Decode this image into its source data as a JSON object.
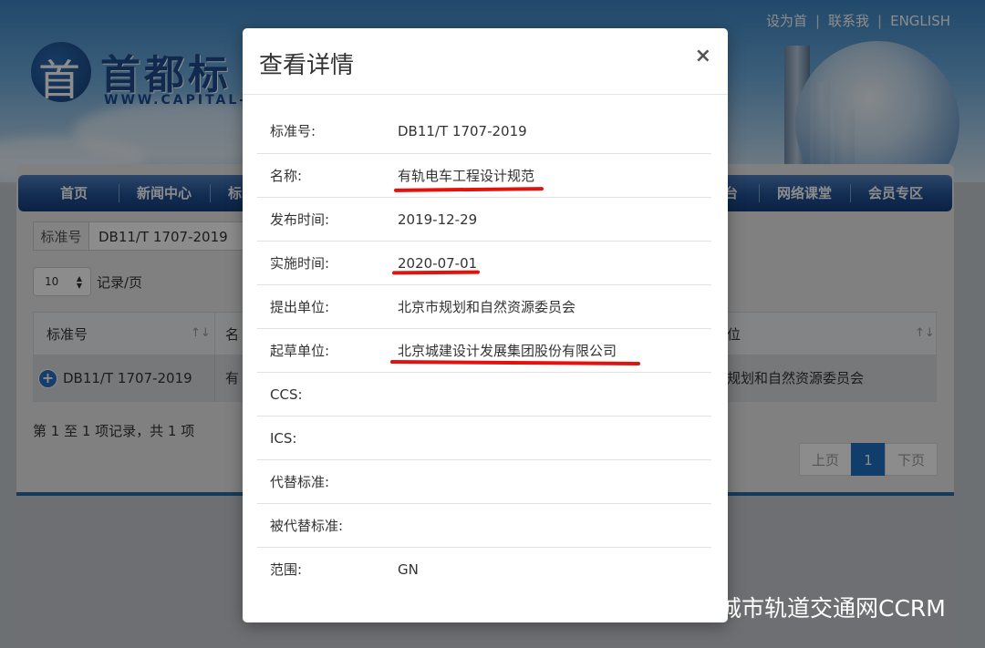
{
  "header": {
    "top_links": [
      "设为首",
      "联系我",
      "ENGLISH"
    ],
    "logo_text": "首都标",
    "logo_url": "WWW.CAPITAL-S"
  },
  "nav": {
    "items": [
      "首页",
      "新闻中心",
      "标",
      "台",
      "网络课堂",
      "会员专区"
    ]
  },
  "search": {
    "label": "标准号",
    "value": "DB11/T 1707-2019"
  },
  "page_size": {
    "value": "10",
    "label": "记录/页"
  },
  "table": {
    "headers": [
      "标准号",
      "名",
      "位"
    ],
    "row": {
      "code": "DB11/T 1707-2019",
      "name_partial": "有",
      "org_partial": "规划和自然资源委员会"
    }
  },
  "summary": "第 1 至 1 项记录，共 1 项",
  "pager": {
    "prev": "上页",
    "current": "1",
    "next": "下页"
  },
  "modal": {
    "title": "查看详情",
    "close": "×",
    "fields": [
      {
        "label": "标准号:",
        "value": "DB11/T 1707-2019"
      },
      {
        "label": "名称:",
        "value": "有轨电车工程设计规范"
      },
      {
        "label": "发布时间:",
        "value": "2019-12-29"
      },
      {
        "label": "实施时间:",
        "value": "2020-07-01"
      },
      {
        "label": "提出单位:",
        "value": "北京市规划和自然资源委员会"
      },
      {
        "label": "起草单位:",
        "value": "北京城建设计发展集团股份有限公司"
      },
      {
        "label": "CCS:",
        "value": ""
      },
      {
        "label": "ICS:",
        "value": ""
      },
      {
        "label": "代替标准:",
        "value": ""
      },
      {
        "label": "被代替标准:",
        "value": ""
      },
      {
        "label": "范围:",
        "value": "GN"
      }
    ]
  },
  "watermark": {
    "text": "城市轨道交通网CCRM"
  },
  "colors": {
    "nav_blue": "#1f4f92",
    "pager_active": "#1e6fc2",
    "annotation_red": "#e2120f"
  }
}
